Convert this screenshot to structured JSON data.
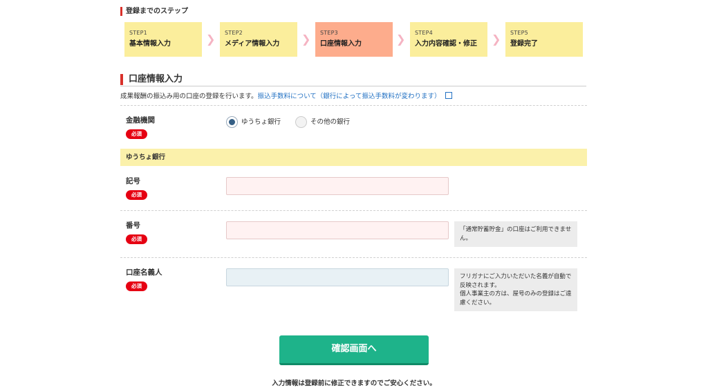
{
  "steps_heading": "登録までのステップ",
  "steps": [
    {
      "num": "STEP1",
      "label": "基本情報入力"
    },
    {
      "num": "STEP2",
      "label": "メディア情報入力"
    },
    {
      "num": "STEP3",
      "label": "口座情報入力"
    },
    {
      "num": "STEP4",
      "label": "入力内容確認・修正"
    },
    {
      "num": "STEP5",
      "label": "登録完了"
    }
  ],
  "section_title": "口座情報入力",
  "description": {
    "text": "成果報酬の振込み用の口座の登録を行います。",
    "link": "振込手数料について（銀行によって振込手数料が変わります）"
  },
  "required_badge": "必須",
  "bank_field": {
    "label": "金融機関",
    "options": [
      "ゆうちょ銀行",
      "その他の銀行"
    ],
    "selected": "ゆうちょ銀行"
  },
  "band_title": "ゆうちょ銀行",
  "fields": {
    "symbol": {
      "label": "記号",
      "value": "",
      "placeholder": ""
    },
    "number": {
      "label": "番号",
      "value": "",
      "placeholder": "",
      "note": "「通常貯蓄貯金」の口座はご利用できません。"
    },
    "holder": {
      "label": "口座名義人",
      "value": "",
      "placeholder": "",
      "note1": "フリガナにご入力いただいた名義が自動で反映されます。",
      "note2": "個人事業主の方は、屋号のみの登録はご遠慮ください。"
    }
  },
  "confirm_button": "確認画面へ",
  "footer_note": "入力情報は登録前に修正できますのでご安心ください。",
  "colors": {
    "accent_red": "#d9312b",
    "step_yellow": "#fbee9c",
    "step_active": "#fdac8c",
    "button_green": "#1eb38a",
    "link_blue": "#2271c3"
  }
}
